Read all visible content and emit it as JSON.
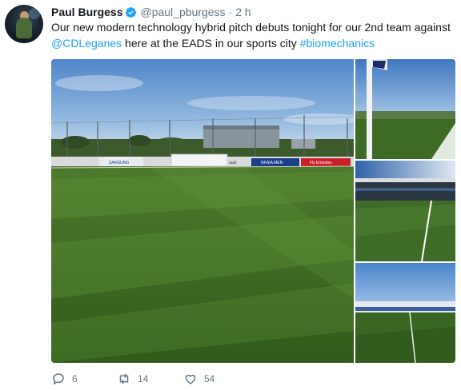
{
  "tweet": {
    "author_name": "Paul Burgess",
    "handle": "@paul_pburgess",
    "separator": "·",
    "time": "2 h",
    "text": {
      "line1": "Our new modern technology hybrid pitch debuts tonight for our 2nd team against",
      "mention": "@CDLeganes",
      "middle": " here at the EADS in our sports city ",
      "hashtag": "#biomechanics"
    }
  },
  "media": {
    "main_ad_boards": [
      "SAMSUNG",
      "audi",
      "NIVEA MEN",
      "Fly Emirates"
    ]
  },
  "actions": {
    "reply_count": "6",
    "retweet_count": "14",
    "like_count": "54"
  },
  "icons": {
    "verified": "verified-badge-icon",
    "reply": "reply-icon",
    "retweet": "retweet-icon",
    "like": "heart-icon"
  },
  "colors": {
    "link": "#1da1f2",
    "secondary_text": "#657786",
    "primary_text": "#14171a",
    "verified": "#1da1f2"
  }
}
